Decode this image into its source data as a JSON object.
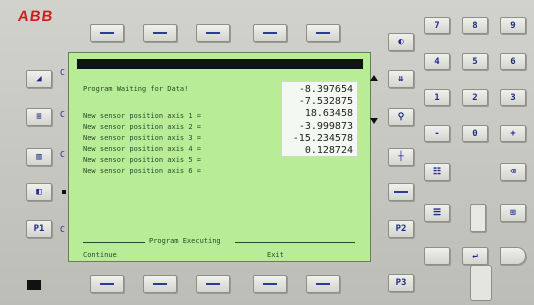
{
  "brand": "ABB",
  "screen": {
    "status_line": "Program Waiting for Data!",
    "sensor_lines": [
      "New sensor position axis 1 =",
      "New sensor position axis 2 =",
      "New sensor position axis 3 =",
      "New sensor position axis 4 =",
      "New sensor position axis 5 =",
      "New sensor position axis 6 ="
    ],
    "values": [
      "-8.397654",
      "-7.532875",
      "18.63458",
      "-3.999873",
      "-15.234578",
      "0.128724"
    ],
    "footer_status": "Program Executing",
    "left_action": "Continue",
    "right_action": "Exit"
  },
  "keys": {
    "p1": "P1",
    "p2": "P2",
    "p3": "P3",
    "numpad": [
      "7",
      "8",
      "9",
      "4",
      "5",
      "6",
      "1",
      "2",
      "3",
      "-",
      "0",
      "+"
    ]
  }
}
